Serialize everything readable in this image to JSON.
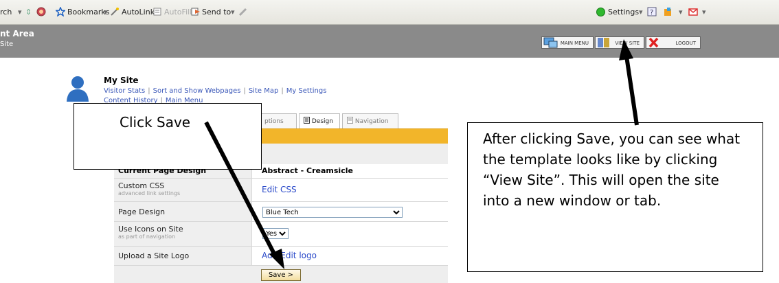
{
  "toolbar": {
    "search_fragment": "rch",
    "items": [
      {
        "label": "Bookmarks",
        "icon": "star-icon"
      },
      {
        "label": "AutoLink",
        "icon": "magic-wand-icon"
      },
      {
        "label": "AutoFill",
        "icon": "autofill-icon"
      },
      {
        "label": "Send to",
        "icon": "send-arrow-icon"
      }
    ],
    "settings_label": "Settings",
    "status_color": "#2fb82f"
  },
  "header": {
    "title_fragment": "nt Area",
    "subtitle_fragment": "Site",
    "buttons": [
      {
        "label": "MAIN MENU",
        "icon": "computer-icon"
      },
      {
        "label": "VIEW SITE",
        "icon": "view-site-icon"
      },
      {
        "label": "LOGOUT",
        "icon": "logout-x-icon"
      }
    ]
  },
  "site": {
    "title": "My Site",
    "links_row1": [
      "Visitor Stats",
      "Sort and Show Webpages",
      "Site Map",
      "My Settings"
    ],
    "links_row2": [
      "Content History",
      "Main Menu"
    ]
  },
  "tabs": [
    {
      "label": "ptions",
      "active": false
    },
    {
      "label": "Design",
      "active": true
    },
    {
      "label": "Navigation",
      "active": false
    }
  ],
  "accent_color": "#f2b52a",
  "table": {
    "header": {
      "label": "Current Page Design",
      "value": "Abstract - Creamsicle"
    },
    "rows": [
      {
        "label": "Custom CSS",
        "sublabel": "advanced link settings",
        "value": "Edit CSS"
      },
      {
        "label": "Page Design",
        "value": "Blue Tech"
      },
      {
        "label": "Use Icons on Site",
        "sublabel": "as part of navigation",
        "value": "Yes"
      },
      {
        "label": "Upload a Site Logo",
        "value": "Add/Edit logo"
      }
    ]
  },
  "save_label": "Save >",
  "callouts": {
    "save_text": "Click Save",
    "view_site_text": "After clicking Save, you can see what the template looks like by clicking “View Site”. This will open the site into a new window or tab."
  }
}
